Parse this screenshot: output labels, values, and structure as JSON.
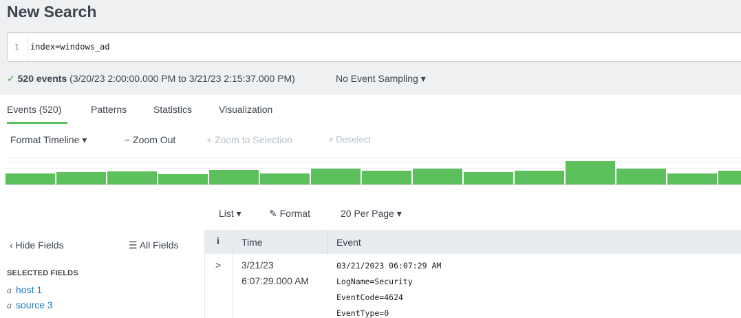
{
  "page": {
    "title": "New Search"
  },
  "search": {
    "line_number": "1",
    "query": "index=windows_ad"
  },
  "status": {
    "check": "✓",
    "events_count": "520 events",
    "range": "(3/20/23 2:00:00.000 PM to 3/21/23 2:15:37.000 PM)",
    "sampling": "No Event Sampling ▾"
  },
  "tabs": [
    {
      "label": "Events (520)",
      "active": true
    },
    {
      "label": "Patterns",
      "active": false
    },
    {
      "label": "Statistics",
      "active": false
    },
    {
      "label": "Visualization",
      "active": false
    }
  ],
  "timeline": {
    "format": "Format Timeline ▾",
    "zoom_out": "− Zoom Out",
    "zoom_selection": "+ Zoom to Selection",
    "deselect": "× Deselect",
    "bar_color": "#5cc05c",
    "bars": [
      16,
      17,
      18,
      15,
      20,
      16,
      22,
      19,
      22,
      17,
      19,
      33,
      22,
      16,
      19
    ]
  },
  "results_controls": {
    "list": "List ▾",
    "format_icon": "pencil-icon",
    "format": "Format",
    "per_page": "20 Per Page ▾"
  },
  "sidebar": {
    "hide_fields": "‹ Hide Fields",
    "all_fields_icon": "list-icon",
    "all_fields": "All Fields",
    "selected_heading": "SELECTED FIELDS",
    "fields": [
      {
        "type": "a",
        "name": "host",
        "count": "1"
      },
      {
        "type": "a",
        "name": "source",
        "count": "3"
      }
    ]
  },
  "table": {
    "info_header": "i",
    "time_header": "Time",
    "event_header": "Event",
    "rows": [
      {
        "expand": ">",
        "date": "3/21/23",
        "time": "6:07:29.000 AM",
        "event_lines": [
          "03/21/2023 06:07:29 AM",
          "LogName=Security",
          "EventCode=4624",
          "EventType=0"
        ]
      }
    ]
  },
  "colors": {
    "accent_green": "#5cc05c",
    "link_blue": "#1a77c8",
    "disabled_gray": "#b6bfc8"
  }
}
